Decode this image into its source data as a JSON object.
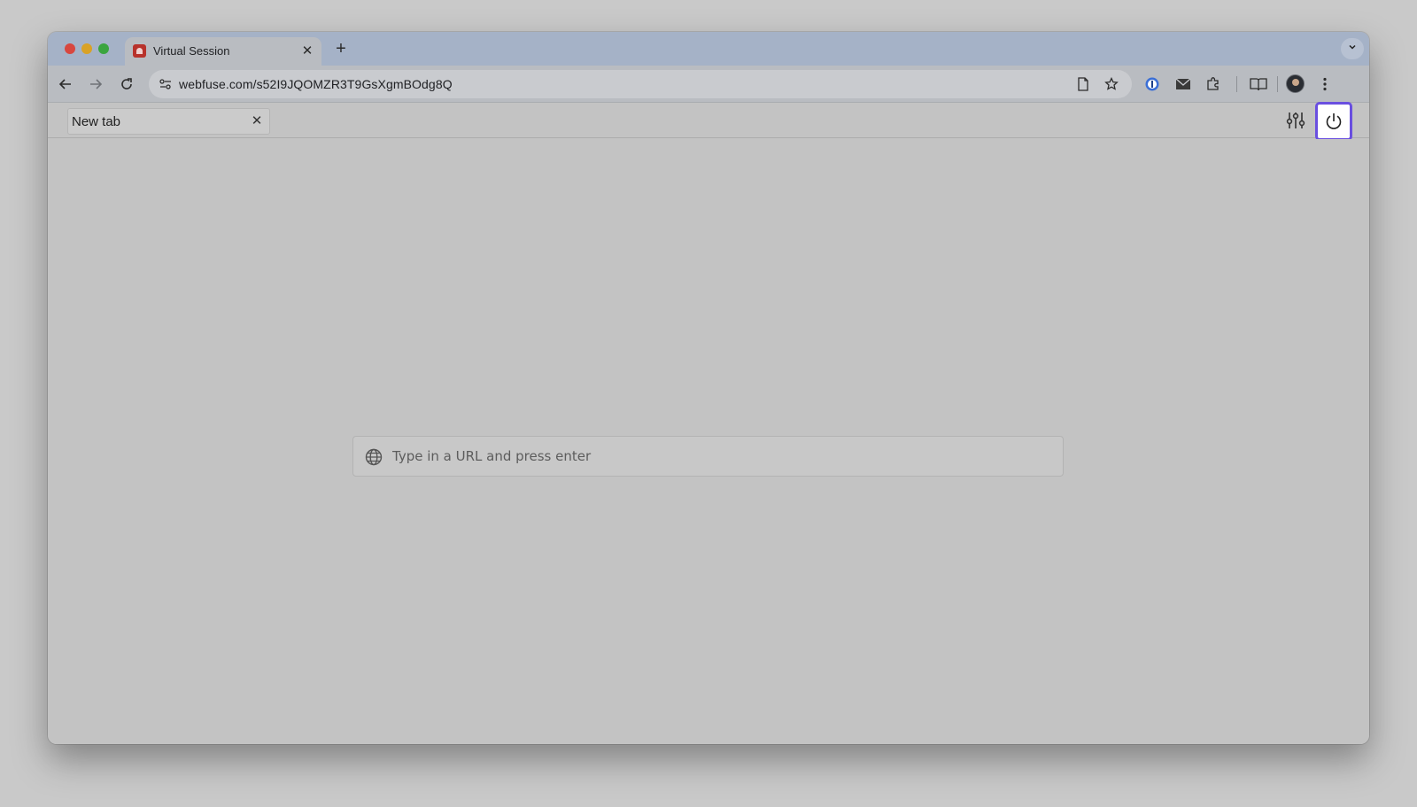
{
  "browser": {
    "tab": {
      "title": "Virtual Session",
      "favicon": "webfuse-favicon-icon",
      "close_glyph": "✕"
    },
    "new_tab_glyph": "+",
    "tabs_dropdown_glyph": "⌄",
    "address_bar": {
      "url": "webfuse.com/s52I9JQOMZR3T9GsXgmBOdg8Q"
    },
    "toolbar_icons": [
      "back-icon",
      "forward-icon",
      "reload-icon",
      "site-info-icon",
      "page-icon",
      "bookmark-star-icon",
      "password-manager-icon",
      "mail-icon",
      "extensions-icon",
      "reading-list-icon",
      "profile-avatar",
      "menu-icon"
    ]
  },
  "webfuse": {
    "tab": {
      "label": "New tab",
      "close_glyph": "✕"
    },
    "icons": [
      "settings-sliders-icon",
      "power-icon"
    ],
    "power_highlight_color": "#6a4fe0"
  },
  "content": {
    "url_input": {
      "placeholder": "Type in a URL and press enter",
      "value": ""
    }
  }
}
